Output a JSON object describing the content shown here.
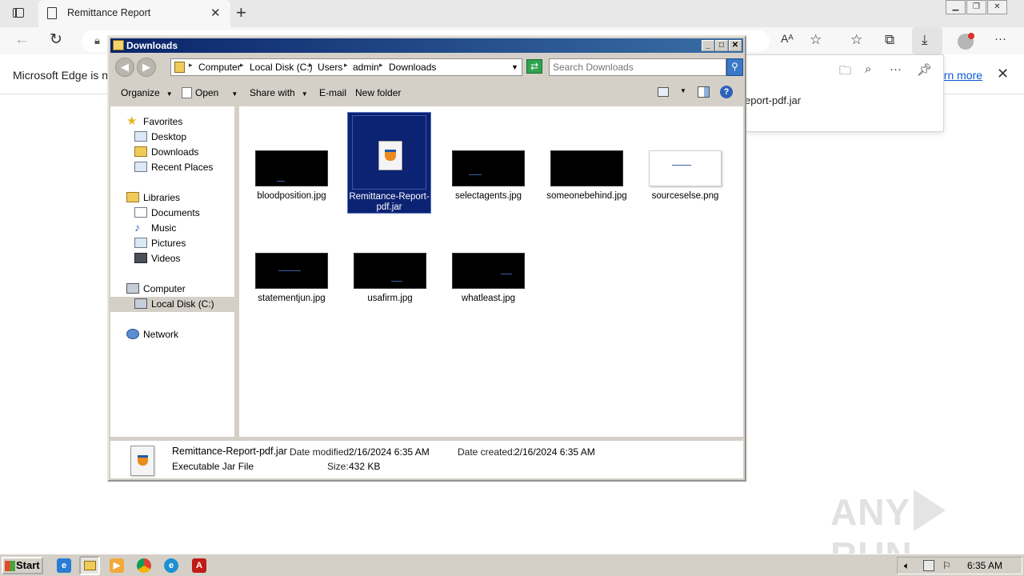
{
  "browser": {
    "tab_title": "Remittance Report",
    "infobar_message": "Microsoft Edge is no",
    "infobar_learn_more": "arn more",
    "downloads_flyout_filename": "eport-pdf.jar",
    "icons": [
      "tab-actions-icon",
      "page-icon",
      "close-icon",
      "plus-icon",
      "back-icon",
      "refresh-icon",
      "lock-icon",
      "read-aloud-icon",
      "add-favorite-icon",
      "favorites-icon",
      "collections-icon",
      "download-icon",
      "profile-icon",
      "more-icon",
      "folder-icon",
      "search-icon",
      "pin-icon"
    ]
  },
  "explorer": {
    "title": "Downloads",
    "breadcrumb": [
      "Computer",
      "Local Disk (C:)",
      "Users",
      "admin",
      "Downloads"
    ],
    "search_placeholder": "Search Downloads",
    "toolbar": {
      "organize": "Organize",
      "open": "Open",
      "share_with": "Share with",
      "email": "E-mail",
      "new_folder": "New folder"
    },
    "nav": {
      "favorites": "Favorites",
      "desktop": "Desktop",
      "downloads": "Downloads",
      "recent_places": "Recent Places",
      "libraries": "Libraries",
      "documents": "Documents",
      "music": "Music",
      "pictures": "Pictures",
      "videos": "Videos",
      "computer": "Computer",
      "local_disk": "Local Disk (C:)",
      "network": "Network"
    },
    "files": [
      {
        "name": "bloodposition.jpg"
      },
      {
        "name": "Remittance-Report-pdf.jar",
        "selected": true
      },
      {
        "name": "selectagents.jpg"
      },
      {
        "name": "someonebehind.jpg"
      },
      {
        "name": "sourceselse.png"
      },
      {
        "name": "statementjun.jpg"
      },
      {
        "name": "usafirm.jpg"
      },
      {
        "name": "whatleast.jpg"
      }
    ],
    "details": {
      "filename": "Remittance-Report-pdf.jar",
      "type": "Executable Jar File",
      "modified_label": "Date modified:",
      "modified_value": "2/16/2024 6:35 AM",
      "created_label": "Date created:",
      "created_value": "2/16/2024 6:35 AM",
      "size_label": "Size:",
      "size_value": "432 KB"
    }
  },
  "watermark": {
    "left": "ANY",
    "right": "RUN"
  },
  "taskbar": {
    "start_label": "Start",
    "clock": "6:35 AM",
    "quick_launch": [
      "ie-icon",
      "explorer-icon",
      "media-player-icon",
      "chrome-icon",
      "edge-icon",
      "acrobat-icon"
    ]
  },
  "colors": {
    "titlebar_start": "#0a246a",
    "titlebar_end": "#3a6ea5",
    "selection": "#0c2272",
    "classic_face": "#d4d0c8",
    "link": "#0b59d2"
  }
}
